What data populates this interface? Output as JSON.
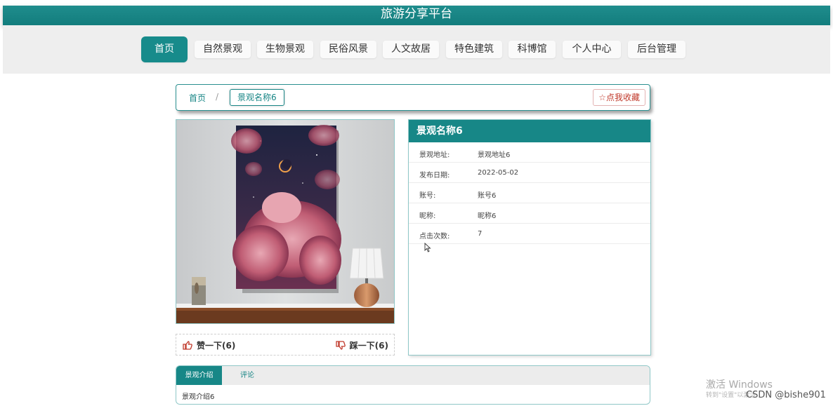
{
  "site": {
    "title": "旅游分享平台"
  },
  "nav": {
    "items": [
      "首页",
      "自然景观",
      "生物景观",
      "民俗风景",
      "人文故居",
      "特色建筑",
      "科博馆",
      "个人中心",
      "后台管理"
    ]
  },
  "breadcrumb": {
    "home": "首页",
    "separator": "/",
    "current": "景观名称6"
  },
  "favorite": {
    "label": "点我收藏"
  },
  "votes": {
    "like_label": "赞一下(6)",
    "dislike_label": "踩一下(6)"
  },
  "detail": {
    "title": "景观名称6",
    "rows": [
      {
        "label": "景观地址:",
        "value": "景观地址6"
      },
      {
        "label": "发布日期:",
        "value": "2022-05-02"
      },
      {
        "label": "账号:",
        "value": "账号6"
      },
      {
        "label": "昵称:",
        "value": "昵称6"
      },
      {
        "label": "点击次数:",
        "value": "7"
      }
    ]
  },
  "tabs": {
    "active": "景观介绍",
    "other": "评论",
    "content": "景观介绍6"
  },
  "overlay": {
    "watermark_title": "激活 Windows",
    "watermark_sub": "转到\"设置\"以激活",
    "csdn": "CSDN @bishe901"
  },
  "colors": {
    "primary": "#178787",
    "danger": "#c0392b"
  }
}
